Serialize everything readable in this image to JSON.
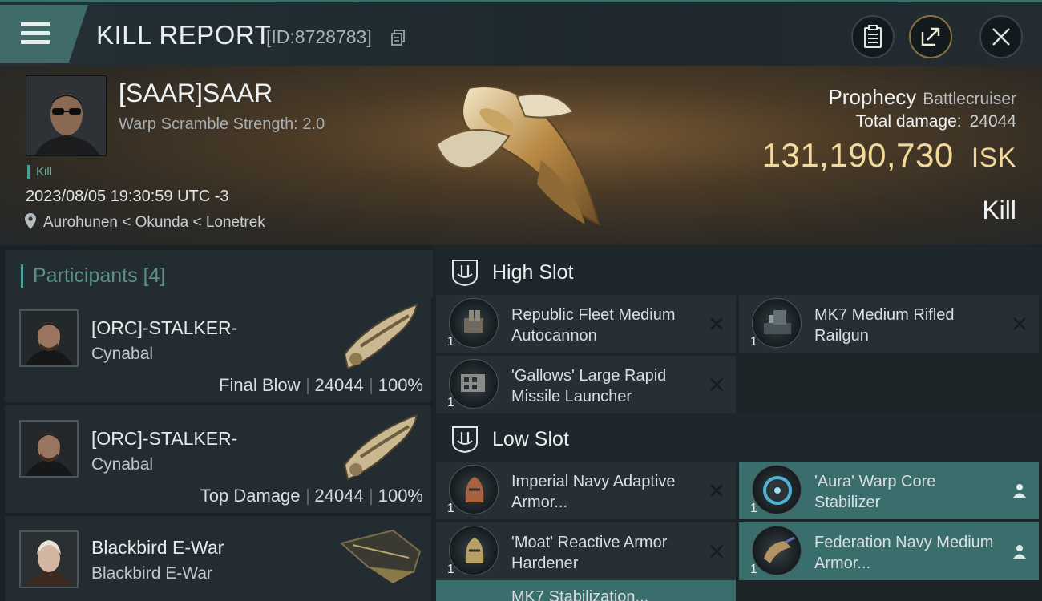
{
  "header": {
    "title": "KILL REPORT",
    "report_id": "[ID:8728783]"
  },
  "victim": {
    "name": "[SAAR]SAAR",
    "warp_strength": "Warp Scramble Strength: 2.0",
    "tag": "Kill",
    "timestamp": "2023/08/05 19:30:59 UTC -3",
    "location": "Aurohunen < Okunda < Lonetrek"
  },
  "ship": {
    "name": "Prophecy",
    "class": "Battlecruiser",
    "total_damage_label": "Total damage:",
    "total_damage": "24044",
    "isk_value": "131,190,730",
    "isk_unit": "ISK",
    "result": "Kill"
  },
  "participants": {
    "label": "Participants",
    "count": "[4]",
    "list": [
      {
        "name": "[ORC]-STALKER-",
        "ship": "Cynabal",
        "role": "Final Blow",
        "damage": "24044",
        "percent": "100%"
      },
      {
        "name": "[ORC]-STALKER-",
        "ship": "Cynabal",
        "role": "Top Damage",
        "damage": "24044",
        "percent": "100%"
      },
      {
        "name": "Blackbird E-War",
        "ship": "Blackbird E-War"
      }
    ]
  },
  "slots": {
    "high": {
      "label": "High Slot",
      "modules": [
        {
          "name": "Republic Fleet Medium Autocannon",
          "qty": "1",
          "status": "destroyed"
        },
        {
          "name": "MK7 Medium Rifled Railgun",
          "qty": "1",
          "status": "destroyed"
        },
        {
          "name": "'Gallows' Large Rapid Missile Launcher",
          "qty": "1",
          "status": "destroyed"
        }
      ]
    },
    "low": {
      "label": "Low Slot",
      "modules": [
        {
          "name": "Imperial Navy Adaptive Armor...",
          "qty": "1",
          "status": "destroyed"
        },
        {
          "name": "'Aura' Warp Core Stabilizer",
          "qty": "1",
          "status": "dropped"
        },
        {
          "name": "'Moat' Reactive Armor Hardener",
          "qty": "1",
          "status": "destroyed"
        },
        {
          "name": "Federation Navy Medium Armor...",
          "qty": "1",
          "status": "dropped"
        }
      ],
      "partial_next": "MK7 Stabilization..."
    }
  },
  "colors": {
    "accent_teal": "#3a6e6c",
    "isk_gold": "#f1d89b"
  }
}
